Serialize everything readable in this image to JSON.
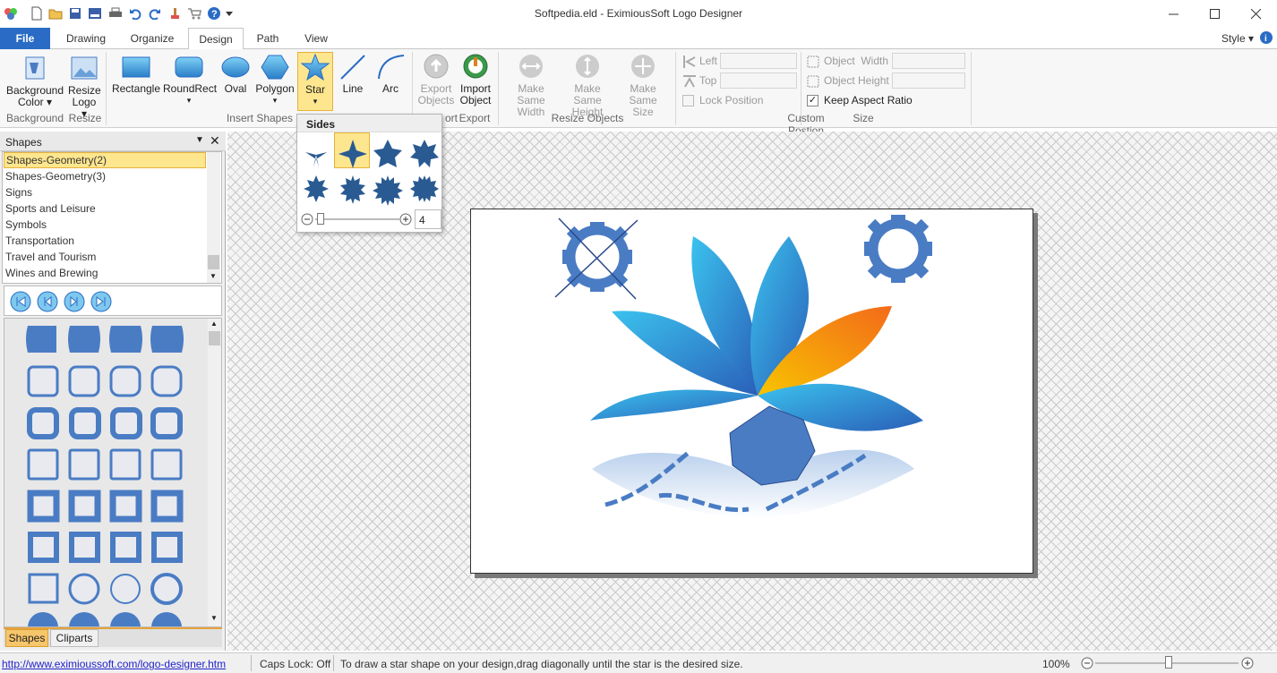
{
  "window": {
    "title": "Softpedia.eld - EximiousSoft Logo Designer"
  },
  "tabs": [
    {
      "label": "File"
    },
    {
      "label": "Drawing"
    },
    {
      "label": "Organize"
    },
    {
      "label": "Design"
    },
    {
      "label": "Path"
    },
    {
      "label": "View"
    }
  ],
  "style_label": "Style",
  "ribbon": {
    "background": {
      "btn1_l1": "Background",
      "btn1_l2": "Color",
      "btn2_l1": "Resize",
      "btn2_l2": "Logo",
      "group": "Background",
      "group2": "Resize"
    },
    "shapes": {
      "rect": "Rectangle",
      "roundrect": "RoundRect",
      "oval": "Oval",
      "polygon": "Polygon",
      "star": "Star",
      "line": "Line",
      "arc": "Arc",
      "group": "Insert Shapes"
    },
    "export": {
      "export_l1": "Export",
      "export_l2": "Objects",
      "import_l1": "Import",
      "import_l2": "Object",
      "group_partial": "ort",
      "group": "Export"
    },
    "resize": {
      "w_l1": "Make Same",
      "w_l2": "Width",
      "h_l1": "Make Same",
      "h_l2": "Height",
      "s_l1": "Make Same",
      "s_l2": "Size",
      "group": "Resize Objects"
    },
    "position": {
      "left": "Left",
      "top": "Top",
      "lock": "Lock Position",
      "group": "Custom Postion"
    },
    "size": {
      "width": "Object  Width",
      "height": "Object Height",
      "keep": "Keep Aspect Ratio",
      "group": "Size"
    }
  },
  "dropdown": {
    "header": "Sides",
    "value": "4"
  },
  "panel": {
    "title": "Shapes",
    "items": [
      "Shapes-Geometry(2)",
      "Shapes-Geometry(3)",
      "Signs",
      "Sports and Leisure",
      "Symbols",
      "Transportation",
      "Travel and Tourism",
      "Wines and Brewing"
    ],
    "bottom_tabs": [
      "Shapes",
      "Cliparts"
    ]
  },
  "status": {
    "link": "http://www.eximioussoft.com/logo-designer.htm",
    "caps": "Caps Lock: Off",
    "hint": "To draw a star shape on your design,drag diagonally until the star is the desired size.",
    "zoom": "100%"
  },
  "colors": {
    "accent": "#2a6cc5",
    "shape_blue": "#4a7cc4",
    "selection": "#fde68e"
  }
}
